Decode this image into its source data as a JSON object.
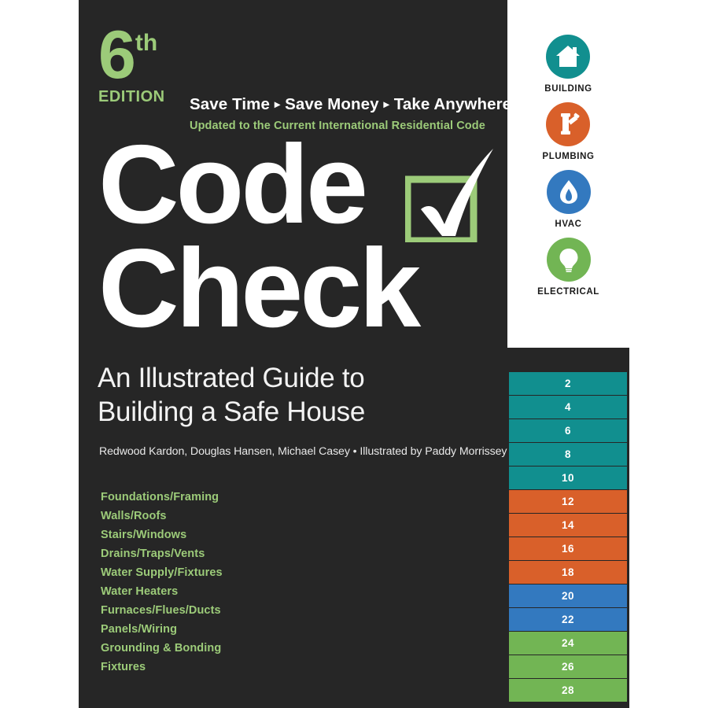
{
  "colors": {
    "dark": "#262626",
    "green_accent": "#9ccb79",
    "teal": "#118f8f",
    "orange": "#d9602a",
    "blue": "#3379bf",
    "leaf_green": "#72b554",
    "white": "#ffffff"
  },
  "edition": {
    "number": "6",
    "superscript": "th",
    "word": "EDITION"
  },
  "tagline": {
    "part1": "Save Time",
    "part2": "Save Money",
    "part3": "Take Anywhere",
    "separator": "▸",
    "updated": "Updated to the Current International Residential Code"
  },
  "title": {
    "line1": "Code",
    "line2": "Check",
    "checkbox_icon": "checkbox-checkmark"
  },
  "subtitle": {
    "line1": "An Illustrated Guide to",
    "line2": "Building a Safe House"
  },
  "authors": "Redwood Kardon, Douglas Hansen, Michael Casey • Illustrated by Paddy Morrissey",
  "topics": [
    "Foundations/Framing",
    "Walls/Roofs",
    "Stairs/Windows",
    "Drains/Traps/Vents",
    "Water Supply/Fixtures",
    "Water Heaters",
    "Furnaces/Flues/Ducts",
    "Panels/Wiring",
    "Grounding & Bonding",
    "Fixtures"
  ],
  "categories": [
    {
      "label": "BUILDING",
      "icon": "house-icon",
      "color": "#118f8f"
    },
    {
      "label": "PLUMBING",
      "icon": "pipe-wye-icon",
      "color": "#d9602a"
    },
    {
      "label": "HVAC",
      "icon": "flame-icon",
      "color": "#3379bf"
    },
    {
      "label": "ELECTRICAL",
      "icon": "lightbulb-icon",
      "color": "#72b554"
    }
  ],
  "page_tabs": [
    {
      "number": "2",
      "color": "#118f8f"
    },
    {
      "number": "4",
      "color": "#118f8f"
    },
    {
      "number": "6",
      "color": "#118f8f"
    },
    {
      "number": "8",
      "color": "#118f8f"
    },
    {
      "number": "10",
      "color": "#118f8f"
    },
    {
      "number": "12",
      "color": "#d9602a"
    },
    {
      "number": "14",
      "color": "#d9602a"
    },
    {
      "number": "16",
      "color": "#d9602a"
    },
    {
      "number": "18",
      "color": "#d9602a"
    },
    {
      "number": "20",
      "color": "#3379bf"
    },
    {
      "number": "22",
      "color": "#3379bf"
    },
    {
      "number": "24",
      "color": "#72b554"
    },
    {
      "number": "26",
      "color": "#72b554"
    },
    {
      "number": "28",
      "color": "#72b554"
    }
  ]
}
